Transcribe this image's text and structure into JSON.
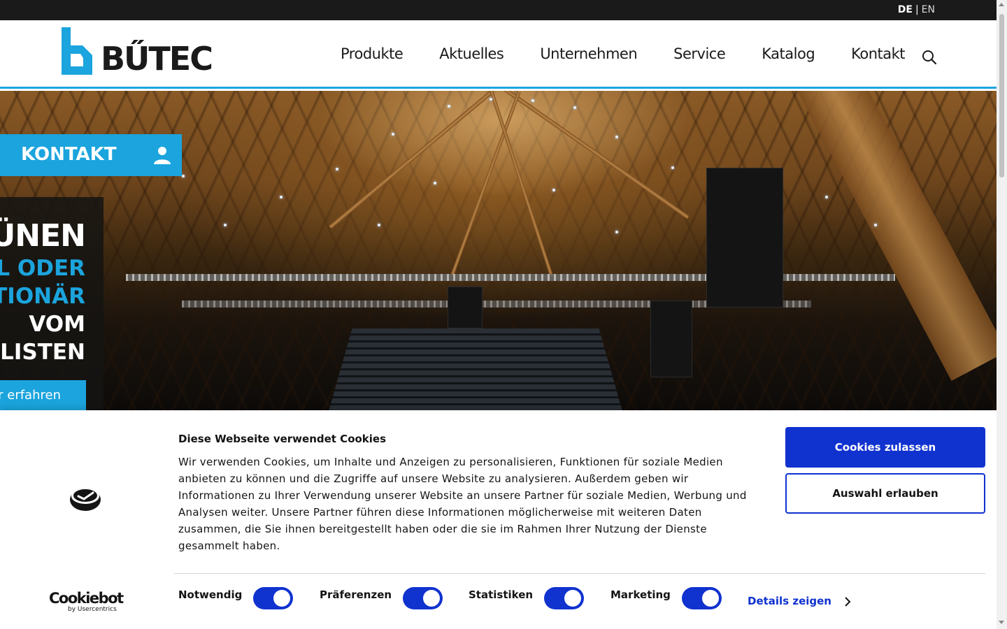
{
  "topbar": {
    "lang_active": "DE",
    "lang_separator": "|",
    "lang_other": "EN"
  },
  "header": {
    "logo_text": "BŰTEC",
    "nav": [
      "Produkte",
      "Aktuelles",
      "Unternehmen",
      "Service",
      "Katalog",
      "Kontakt"
    ],
    "search_icon": "search-icon"
  },
  "hero": {
    "kontakt_label": "KONTAKT",
    "kontakt_icon": "person-icon",
    "headline": [
      "BÜNEN",
      "BIL ODER",
      "ATIONÄR",
      "VOM",
      "ALISTEN"
    ],
    "more_button": "hr erfahren"
  },
  "cookie": {
    "title": "Diese Webseite verwendet Cookies",
    "text": "Wir verwenden Cookies, um Inhalte und Anzeigen zu personalisieren, Funktionen für soziale Medien anbieten zu können und die Zugriffe auf unsere Website zu analysieren. Außerdem geben wir Informationen zu Ihrer Verwendung unserer Website an unsere Partner für soziale Medien, Werbung und Analysen weiter. Unsere Partner führen diese Informationen möglicherweise mit weiteren Daten zusammen, die Sie ihnen bereitgestellt haben oder die sie im Rahmen Ihrer Nutzung der Dienste gesammelt haben.",
    "allow_all": "Cookies zulassen",
    "allow_selection": "Auswahl erlauben",
    "toggles": [
      {
        "label": "Notwendig",
        "on": true
      },
      {
        "label": "Präferenzen",
        "on": true
      },
      {
        "label": "Statistiken",
        "on": true
      },
      {
        "label": "Marketing",
        "on": true
      }
    ],
    "details_link": "Details zeigen",
    "brand_name": "Cookiebot",
    "brand_sub": "by Usercentrics"
  },
  "colors": {
    "brand_blue": "#1ba4dd",
    "cookie_blue": "#1032cf",
    "dark": "#1a1a1a"
  }
}
